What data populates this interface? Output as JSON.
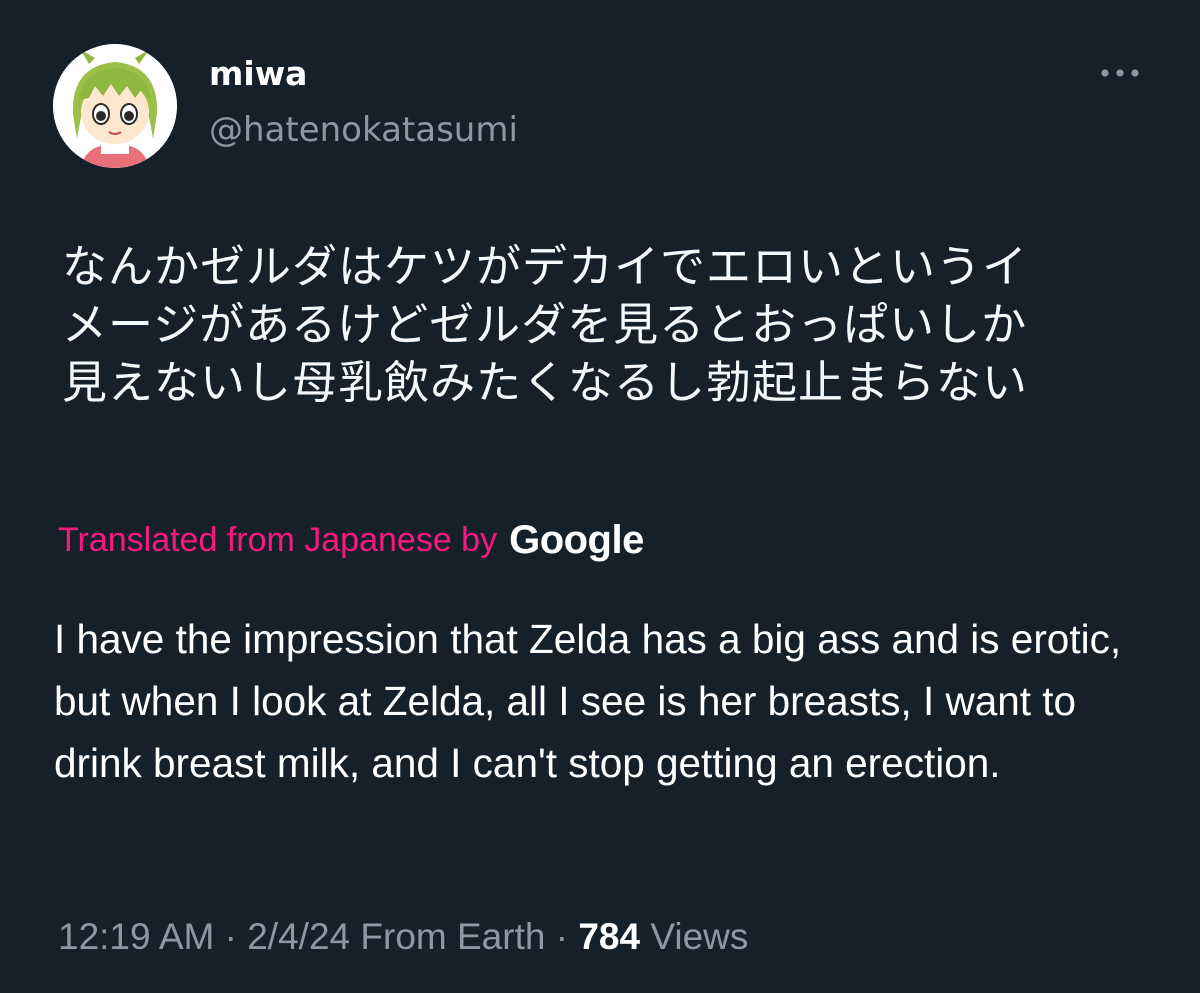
{
  "tweet": {
    "display_name": "miwa",
    "handle": "@hatenokatasumi",
    "more_icon": "more-horizontal-icon",
    "original_text": "なんかゼルダはケツがデカイでエロいというイ\nメージがあるけどゼルダを見るとおっぱいしか\n見えないし母乳飲みたくなるし勃起止まらない",
    "translation_label": "Translated from Japanese by",
    "translation_provider": "Google",
    "translated_text": "I have the impression that Zelda has a big ass and is erotic, but when I look at Zelda, all I see is her breasts, I want to drink breast milk, and I can't stop getting an erection.",
    "time": "12:19 AM",
    "separator": "·",
    "date": "2/4/24",
    "source": "From Earth",
    "view_count": "784",
    "views_label": "Views"
  },
  "colors": {
    "background": "#15202b",
    "primary_text": "#ffffff",
    "secondary_text": "#8b98a5",
    "translation_accent": "#f91880"
  }
}
